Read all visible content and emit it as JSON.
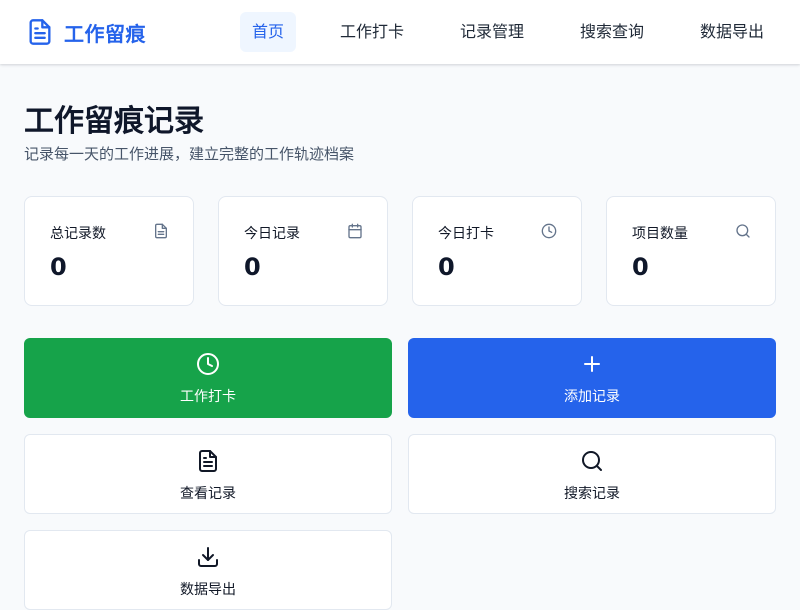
{
  "brand": {
    "name": "工作留痕",
    "icon": "document-icon"
  },
  "nav": {
    "items": [
      {
        "label": "首页",
        "active": true
      },
      {
        "label": "工作打卡",
        "active": false
      },
      {
        "label": "记录管理",
        "active": false
      },
      {
        "label": "搜索查询",
        "active": false
      },
      {
        "label": "数据导出",
        "active": false
      }
    ]
  },
  "page": {
    "title": "工作留痕记录",
    "subtitle": "记录每一天的工作进展，建立完整的工作轨迹档案"
  },
  "stats": [
    {
      "label": "总记录数",
      "value": "0",
      "icon": "document-icon"
    },
    {
      "label": "今日记录",
      "value": "0",
      "icon": "calendar-icon"
    },
    {
      "label": "今日打卡",
      "value": "0",
      "icon": "clock-icon"
    },
    {
      "label": "项目数量",
      "value": "0",
      "icon": "search-icon"
    }
  ],
  "actions": [
    {
      "label": "工作打卡",
      "icon": "clock-icon",
      "color": "#16a34a"
    },
    {
      "label": "添加记录",
      "icon": "plus-icon",
      "color": "#2563eb"
    },
    {
      "label": "查看记录",
      "icon": "document-icon"
    },
    {
      "label": "搜索记录",
      "icon": "search-icon"
    },
    {
      "label": "数据导出",
      "icon": "download-icon"
    }
  ],
  "colors": {
    "accent": "#2563eb",
    "success": "#16a34a",
    "background": "#f8fafc",
    "border": "#e2e8f0"
  }
}
